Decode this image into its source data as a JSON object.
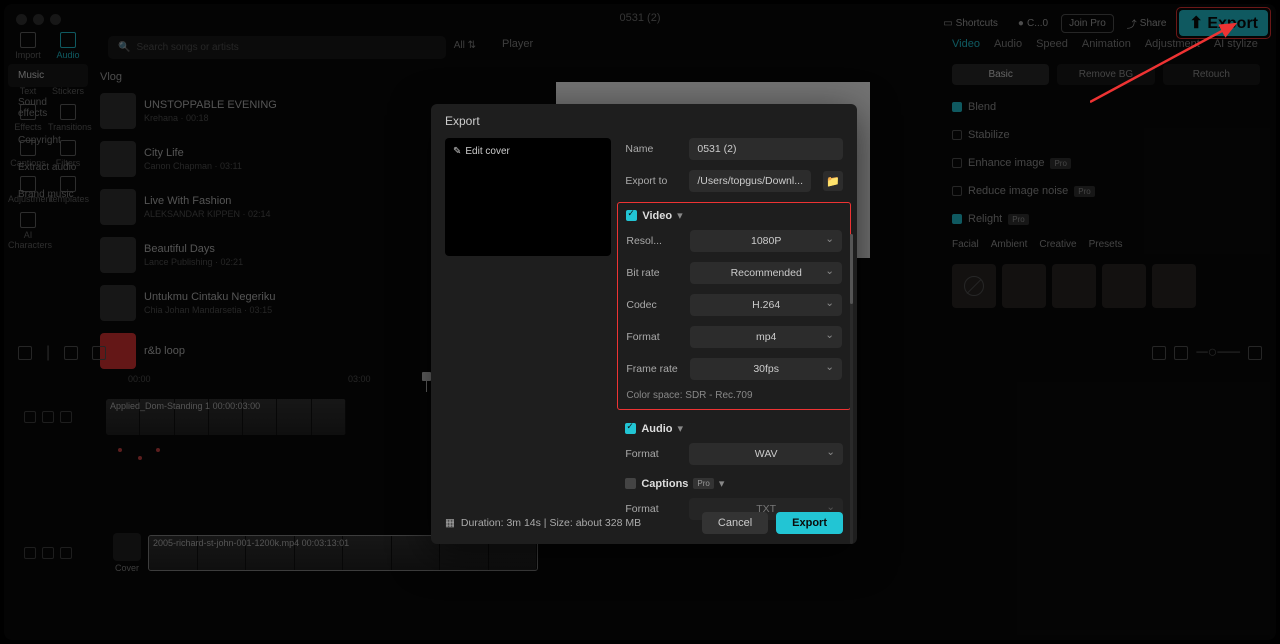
{
  "window_title": "0531 (2)",
  "topbar": {
    "shortcuts": "Shortcuts",
    "rec": "C...0",
    "joinpro": "Join Pro",
    "share": "Share",
    "export": "Export"
  },
  "sidebar": [
    {
      "label": "Import"
    },
    {
      "label": "Audio"
    },
    {
      "label": "Text"
    },
    {
      "label": "Stickers"
    },
    {
      "label": "Effects"
    },
    {
      "label": "Transitions"
    },
    {
      "label": "Captions"
    },
    {
      "label": "Filters"
    },
    {
      "label": "Adjustment"
    },
    {
      "label": "Templates"
    },
    {
      "label": "AI Characters"
    }
  ],
  "left_tabs": [
    "Music",
    "Sound effects",
    "Copyright",
    "Extract audio",
    "Brand music"
  ],
  "search_placeholder": "Search songs or artists",
  "all": "All",
  "vlog_heading": "Vlog",
  "tracks": [
    {
      "title": "UNSTOPPABLE EVENING",
      "sub": "Krehana · 00:18"
    },
    {
      "title": "City Life",
      "sub": "Canon Chapman · 03:11"
    },
    {
      "title": "Live With Fashion",
      "sub": "ALEKSANDAR KIPPEN · 02:14"
    },
    {
      "title": "Beautiful Days",
      "sub": "Lance Publishing · 02:21"
    },
    {
      "title": "Untukmu Cintaku Negeriku",
      "sub": "Chia Johan Mandarsetia · 03:15"
    },
    {
      "title": "r&b loop",
      "sub": ""
    }
  ],
  "player_label": "Player",
  "right_tabs": [
    "Video",
    "Audio",
    "Speed",
    "Animation",
    "Adjustment",
    "AI stylize"
  ],
  "right_pills": [
    "Basic",
    "Remove BG",
    "Retouch"
  ],
  "right_opts": {
    "blend": "Blend",
    "stabilize": "Stabilize",
    "enhance": "Enhance image",
    "noise": "Reduce image noise",
    "relight": "Relight",
    "pro": "Pro"
  },
  "presets": [
    "Facial",
    "Ambient",
    "Creative",
    "Presets"
  ],
  "modal": {
    "title": "Export",
    "edit_cover": "Edit cover",
    "name_label": "Name",
    "name_value": "0531 (2)",
    "exportto_label": "Export to",
    "exportto_value": "/Users/topgus/Downl...",
    "video": "Video",
    "res_label": "Resol...",
    "res_value": "1080P",
    "bitrate_label": "Bit rate",
    "bitrate_value": "Recommended",
    "codec_label": "Codec",
    "codec_value": "H.264",
    "format_label": "Format",
    "format_value": "mp4",
    "fps_label": "Frame rate",
    "fps_value": "30fps",
    "colorspace": "Color space: SDR - Rec.709",
    "audio": "Audio",
    "audio_format_label": "Format",
    "audio_format_value": "WAV",
    "captions": "Captions",
    "captions_format_label": "Format",
    "captions_format_value": "TXT",
    "duration": "Duration: 3m 14s | Size: about 328 MB",
    "cancel": "Cancel",
    "export": "Export"
  },
  "timeline": {
    "ticks": [
      "00:00",
      "03:00"
    ],
    "clip1": "Applied_Dom-Standing 1  00:00:03:00",
    "clip2": "2005-richard-st-john-001-1200k.mp4  00:03:13:01",
    "cover": "Cover"
  }
}
